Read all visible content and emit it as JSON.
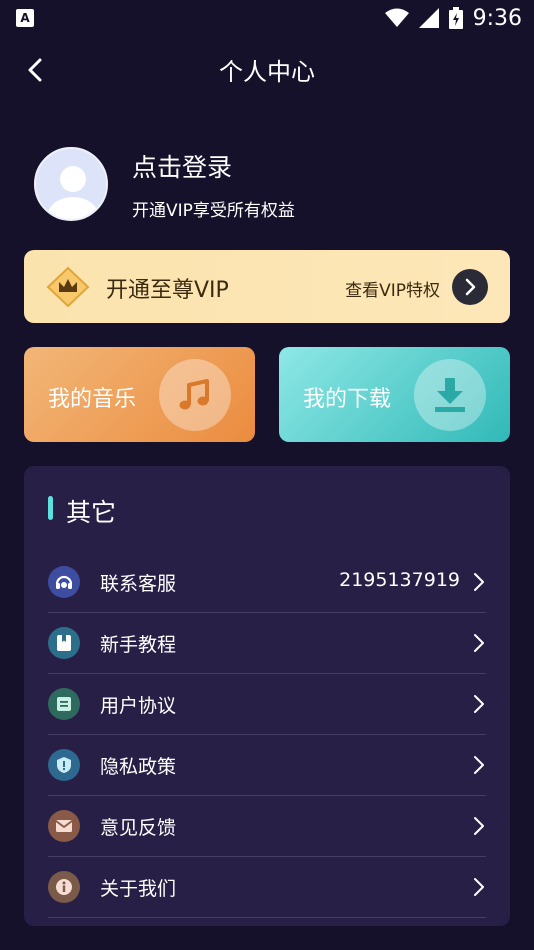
{
  "status_bar": {
    "time": "9:36",
    "app_icon_letter": "A"
  },
  "header": {
    "title": "个人中心"
  },
  "profile": {
    "title": "点击登录",
    "subtitle": "开通VIP享受所有权益"
  },
  "vip_banner": {
    "title": "开通至尊VIP",
    "link": "查看VIP特权"
  },
  "cards": {
    "music": {
      "label": "我的音乐"
    },
    "download": {
      "label": "我的下载"
    }
  },
  "other": {
    "title": "其它",
    "items": [
      {
        "label": "联系客服",
        "value": "2195137919",
        "icon": "headset-icon",
        "color": "#3d4ea0"
      },
      {
        "label": "新手教程",
        "value": "",
        "icon": "book-icon",
        "color": "#2b6f8a"
      },
      {
        "label": "用户协议",
        "value": "",
        "icon": "document-icon",
        "color": "#2f6a5e"
      },
      {
        "label": "隐私政策",
        "value": "",
        "icon": "shield-icon",
        "color": "#2e6a8f"
      },
      {
        "label": "意见反馈",
        "value": "",
        "icon": "mail-icon",
        "color": "#8a5a48"
      },
      {
        "label": "关于我们",
        "value": "",
        "icon": "info-icon",
        "color": "#7a5a48"
      }
    ]
  },
  "colors": {
    "background": "#15112a",
    "panel": "#281f46",
    "vip_gold": "#fbe3ae",
    "accent_cyan": "#5fe0e0",
    "music_orange": "#eb8c3f",
    "download_teal": "#31b9b7"
  }
}
